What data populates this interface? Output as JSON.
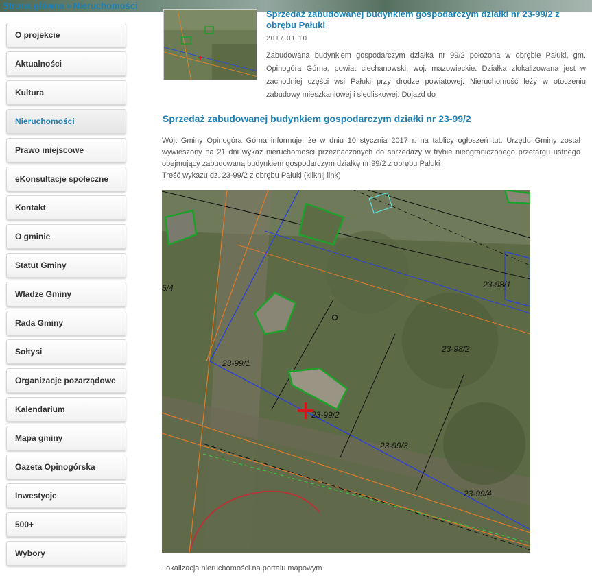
{
  "breadcrumb": {
    "home": "Strona główna",
    "separator": "»",
    "current": "Nieruchomości"
  },
  "sidebar": {
    "items": [
      {
        "label": "O projekcie"
      },
      {
        "label": "Aktualności"
      },
      {
        "label": "Kultura"
      },
      {
        "label": "Nieruchomości",
        "active": true
      },
      {
        "label": "Prawo miejscowe"
      },
      {
        "label": "eKonsultacje społeczne"
      },
      {
        "label": "Kontakt"
      },
      {
        "label": "O gminie"
      },
      {
        "label": "Statut Gminy"
      },
      {
        "label": "Władze Gminy"
      },
      {
        "label": "Rada Gminy"
      },
      {
        "label": "Sołtysi"
      },
      {
        "label": "Organizacje pozarządowe"
      },
      {
        "label": "Kalendarium"
      },
      {
        "label": "Mapa gminy"
      },
      {
        "label": "Gazeta Opinogórska"
      },
      {
        "label": "Inwestycje"
      },
      {
        "label": "500+"
      },
      {
        "label": "Wybory"
      }
    ]
  },
  "teaser": {
    "title": "Sprzedaż zabudowanej budynkiem gospodarczym działki nr 23-99/2 z obrębu Pałuki",
    "date": "2017.01.10",
    "text": "Zabudowana budynkiem gospodarczym działka nr 99/2 położona w obrębie Pałuki, gm. Opinogóra Górna, powiat ciechanowski, woj. mazowieckie. Działka zlokalizowana jest w zachodniej części wsi Pałuki przy drodze powiatowej. Nieruchomość leży w otoczeniu zabudowy mieszkaniowej i siedliskowej. Dojazd do"
  },
  "article": {
    "title": "Sprzedaż zabudowanej budynkiem gospodarczym działki nr 23-99/2",
    "body": "Wójt Gminy Opinogóra Górna informuje, że w dniu 10 stycznia 2017 r. na tablicy ogłoszeń tut. Urzędu Gminy został wywieszony na 21 dni wykaz nieruchomości przeznaczonych do sprzedaży w trybie nieograniczonego przetargu ustnego obejmujący zabudowaną budynkiem gospodarczym działkę nr 99/2 z obrębu Pałuki",
    "link": "Treść wykazu dz. 23-99/2 z obrębu Pałuki (kliknij link)",
    "caption": "Lokalizacja nieruchomości na portalu mapowym"
  },
  "map": {
    "labels": {
      "plot_99_2": "23-99/2",
      "plot_99_1": "23-99/1",
      "plot_99_3": "23-99/3",
      "plot_99_4": "23-99/4",
      "plot_98_1": "23-98/1",
      "plot_98_2": "23-98/2",
      "plot_99_5": "99/3",
      "plot_left": "5/4"
    }
  }
}
